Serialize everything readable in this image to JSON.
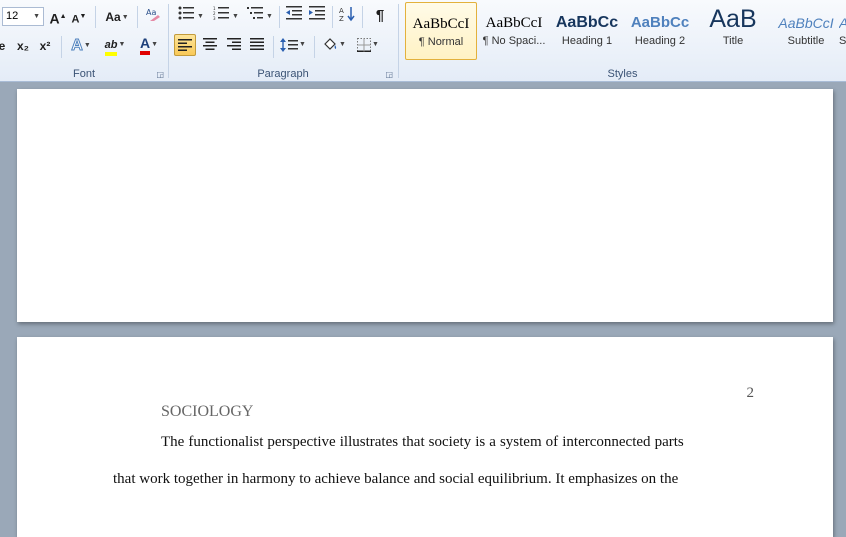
{
  "ribbon": {
    "font": {
      "size_value": "12",
      "grow_label": "A",
      "shrink_label": "A",
      "case_label": "Aa",
      "subscript_label": "x₂",
      "superscript_label": "x²",
      "text_effects_label": "A",
      "highlight_label": "ab",
      "font_color_label": "A",
      "group_label": "Font"
    },
    "paragraph": {
      "pilcrow_label": "¶",
      "group_label": "Paragraph"
    },
    "styles": {
      "group_label": "Styles",
      "items": [
        {
          "preview": "AaBbCcI",
          "name": "¶ Normal"
        },
        {
          "preview": "AaBbCcI",
          "name": "¶ No Spaci..."
        },
        {
          "preview": "AaBbCc",
          "name": "Heading 1"
        },
        {
          "preview": "AaBbCc",
          "name": "Heading 2"
        },
        {
          "preview": "AaB",
          "name": "Title"
        },
        {
          "preview": "AaBbCcI",
          "name": "Subtitle"
        },
        {
          "preview": "A",
          "name": "S"
        }
      ]
    }
  },
  "document": {
    "page_number": "2",
    "running_head": "SOCIOLOGY",
    "lines": [
      "The functionalist perspective illustrates that society is a system of interconnected parts",
      "that work together in harmony to achieve balance and social equilibrium.  It emphasizes on the"
    ]
  },
  "colors": {
    "highlight": "#ffff00",
    "font_color": "#e00000",
    "heading_blue": "#17365d",
    "accent_blue": "#4f81bd"
  }
}
